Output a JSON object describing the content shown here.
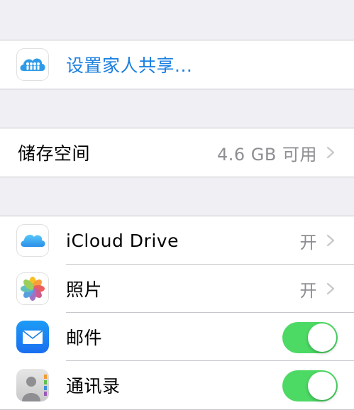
{
  "family": {
    "label": "设置家人共享..."
  },
  "storage": {
    "label": "储存空间",
    "value": "4.6 GB 可用"
  },
  "apps": [
    {
      "label": "iCloud Drive",
      "value": "开"
    },
    {
      "label": "照片",
      "value": "开"
    },
    {
      "label": "邮件",
      "enabled": true
    },
    {
      "label": "通讯录",
      "enabled": true
    }
  ],
  "colors": {
    "accent": "#1a7fe0",
    "toggle_on": "#4cd964",
    "background": "#efeff4",
    "separator": "#c8c7cc",
    "secondary_text": "#8e8e93"
  },
  "icons": [
    "family-sharing-icon",
    "chevron-right-icon",
    "icloud-drive-icon",
    "photos-icon",
    "mail-icon",
    "contacts-icon"
  ]
}
